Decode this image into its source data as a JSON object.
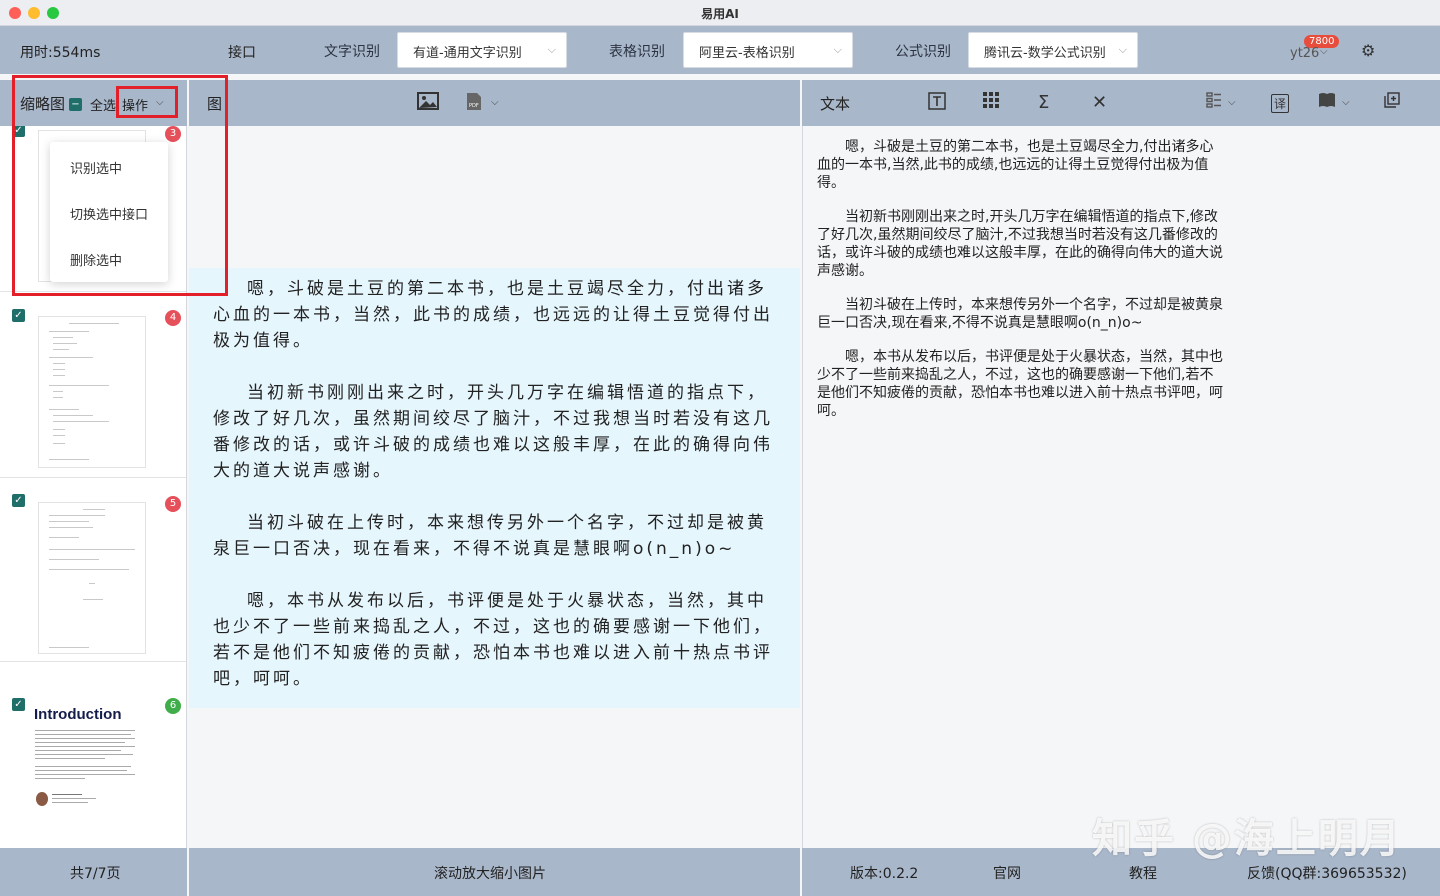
{
  "window": {
    "title": "易用AI"
  },
  "toolbar": {
    "elapsed": "用时:554ms",
    "interface_label": "接口",
    "text_ocr_label": "文字识别",
    "text_ocr_value": "有道-通用文字识别",
    "table_ocr_label": "表格识别",
    "table_ocr_value": "阿里云-表格识别",
    "formula_ocr_label": "公式识别",
    "formula_ocr_value": "腾讯云-数学公式识别",
    "user_name": "yt26",
    "user_badge": "7800"
  },
  "thumb_panel": {
    "title": "缩略图",
    "select_all": "全选",
    "actions": "操作",
    "menu": [
      "识别选中",
      "切换选中接口",
      "删除选中"
    ],
    "badges": [
      "3",
      "4",
      "5",
      "6"
    ],
    "intro_title": "Introduction",
    "footer": "共7/7页"
  },
  "image_panel": {
    "title": "图",
    "footer": "滚动放大缩小图片",
    "ocr_paragraphs": [
      "嗯，斗破是土豆的第二本书，也是土豆竭尽全力，付出诸多心血的一本书，当然，此书的成绩，也远远的让得土豆觉得付出极为值得。",
      "当初新书刚刚出来之时，开头几万字在编辑悟道的指点下，修改了好几次，虽然期间绞尽了脑汁，不过我想当时若没有这几番修改的话，或许斗破的成绩也难以这般丰厚，在此的确得向伟大的道大说声感谢。",
      "当初斗破在上传时，本来想传另外一个名字，不过却是被黄泉巨一口否决，现在看来，不得不说真是慧眼啊o(n_n)o~",
      "嗯，本书从发布以后，书评便是处于火暴状态，当然，其中也少不了一些前来捣乱之人，不过，这也的确要感谢一下他们，若不是他们不知疲倦的贡献，恐怕本书也难以进入前十热点书评吧，呵呵。"
    ]
  },
  "text_panel": {
    "title": "文本",
    "paragraphs": [
      "嗯，斗破是土豆的第二本书，也是土豆竭尽全力,付出诸多心血的一本书,当然,此书的成绩,也远远的让得土豆觉得付出极为值得。",
      "当初新书刚刚出来之时,开头几万字在编辑悟道的指点下,修改了好几次,虽然期间绞尽了脑汁,不过我想当时若没有这几番修改的话，或许斗破的成绩也难以这般丰厚，在此的确得向伟大的道大说声感谢。",
      "当初斗破在上传时，本来想传另外一个名字，不过却是被黄泉巨一口否决,现在看来,不得不说真是慧眼啊o(n_n)o~",
      "嗯，本书从发布以后，书评便是处于火暴状态，当然，其中也少不了一些前来捣乱之人，不过，这也的确要感谢一下他们,若不是他们不知疲倦的贡献，恐怕本书也难以进入前十热点书评吧，呵呵。"
    ],
    "version": "版本:0.2.2",
    "website": "官网",
    "tutorial": "教程",
    "feedback": "反馈(QQ群:369653532)"
  },
  "watermark": "知乎 @海上明月"
}
